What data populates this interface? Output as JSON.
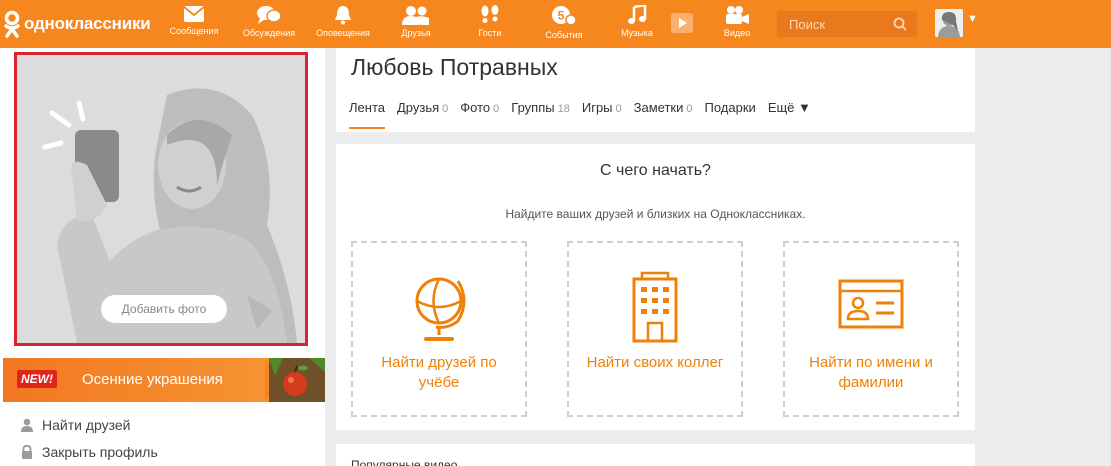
{
  "header": {
    "logo_text": "одноклассники",
    "nav": [
      {
        "label": "Сообщения",
        "icon": "envelope-icon"
      },
      {
        "label": "Обсуждения",
        "icon": "chat-bubbles-icon"
      },
      {
        "label": "Оповещения",
        "icon": "bell-icon"
      },
      {
        "label": "Друзья",
        "icon": "friends-icon"
      },
      {
        "label": "Гости",
        "icon": "footprints-icon"
      },
      {
        "label": "События",
        "icon": "events-icon",
        "badge": "5"
      },
      {
        "label": "Музыка",
        "icon": "music-note-icon"
      },
      {
        "label": "Видео",
        "icon": "video-camera-icon"
      }
    ],
    "search_placeholder": "Поиск",
    "caret": "▼"
  },
  "left": {
    "add_photo_label": "Добавить фото",
    "promo_badge": "NEW!",
    "promo_title": "Осенние украшения",
    "links": [
      "Найти друзей",
      "Закрыть профиль"
    ]
  },
  "profile": {
    "name": "Любовь Потравных",
    "tabs": [
      {
        "label": "Лента",
        "count": ""
      },
      {
        "label": "Друзья",
        "count": "0"
      },
      {
        "label": "Фото",
        "count": "0"
      },
      {
        "label": "Группы",
        "count": "18"
      },
      {
        "label": "Игры",
        "count": "0"
      },
      {
        "label": "Заметки",
        "count": "0"
      },
      {
        "label": "Подарки",
        "count": ""
      },
      {
        "label": "Ещё ▼",
        "count": ""
      }
    ]
  },
  "start": {
    "title": "С чего начать?",
    "subtitle": "Найдите ваших друзей и близких на Одноклассниках.",
    "tiles": [
      {
        "label": "Найти друзей по учёбе",
        "icon": "globe-icon"
      },
      {
        "label": "Найти своих коллег",
        "icon": "office-building-icon"
      },
      {
        "label": "Найти по имени и фамилии",
        "icon": "id-card-icon"
      }
    ]
  },
  "videos": {
    "title": "Популярные видео"
  },
  "colors": {
    "brand": "#f6871f",
    "accent_text": "#ee8208",
    "highlight_border": "#d9262e"
  }
}
